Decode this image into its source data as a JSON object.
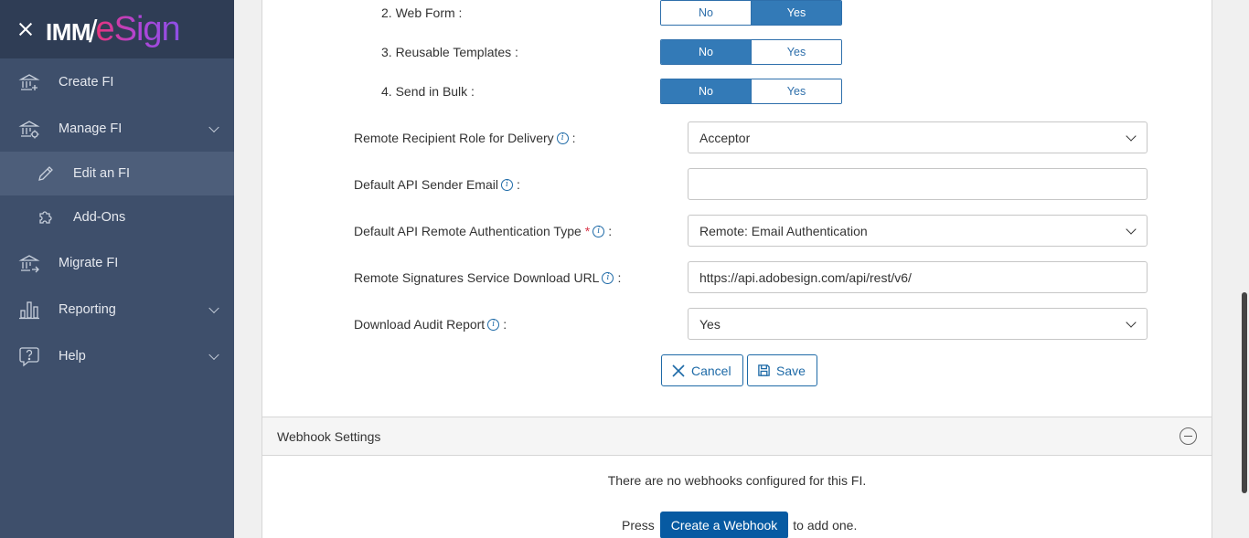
{
  "brand": {
    "imm": "IMM",
    "slash": "/",
    "esign": "eSign"
  },
  "sidebar": {
    "items": [
      {
        "label": "Create FI"
      },
      {
        "label": "Manage FI"
      },
      {
        "label": "Edit an FI"
      },
      {
        "label": "Add-Ons"
      },
      {
        "label": "Migrate FI"
      },
      {
        "label": "Reporting"
      },
      {
        "label": "Help"
      }
    ]
  },
  "form": {
    "toggles": [
      {
        "label": "2. Web Form :",
        "no": "No",
        "yes": "Yes",
        "selected": "Yes"
      },
      {
        "label": "3. Reusable Templates :",
        "no": "No",
        "yes": "Yes",
        "selected": "No"
      },
      {
        "label": "4. Send in Bulk :",
        "no": "No",
        "yes": "Yes",
        "selected": "No"
      }
    ],
    "fields": [
      {
        "label": "Remote Recipient Role for Delivery",
        "suffix": ":",
        "value": "Acceptor",
        "type": "select"
      },
      {
        "label": "Default API Sender Email",
        "suffix": ":",
        "value": "",
        "type": "text"
      },
      {
        "label": "Default API Remote Authentication Type",
        "required": "*",
        "suffix": ":",
        "value": "Remote: Email Authentication",
        "type": "select"
      },
      {
        "label": "Remote Signatures Service Download URL",
        "suffix": ":",
        "value": "https://api.adobesign.com/api/rest/v6/",
        "type": "text"
      },
      {
        "label": "Download Audit Report",
        "suffix": ":",
        "value": "Yes",
        "type": "select"
      }
    ],
    "info_glyph": "i",
    "cancel_label": "Cancel",
    "save_label": "Save"
  },
  "webhook": {
    "title": "Webhook Settings",
    "empty_message": "There are no webhooks configured for this FI.",
    "press": "Press",
    "create_label": "Create a Webhook",
    "to_add": "to add one."
  }
}
